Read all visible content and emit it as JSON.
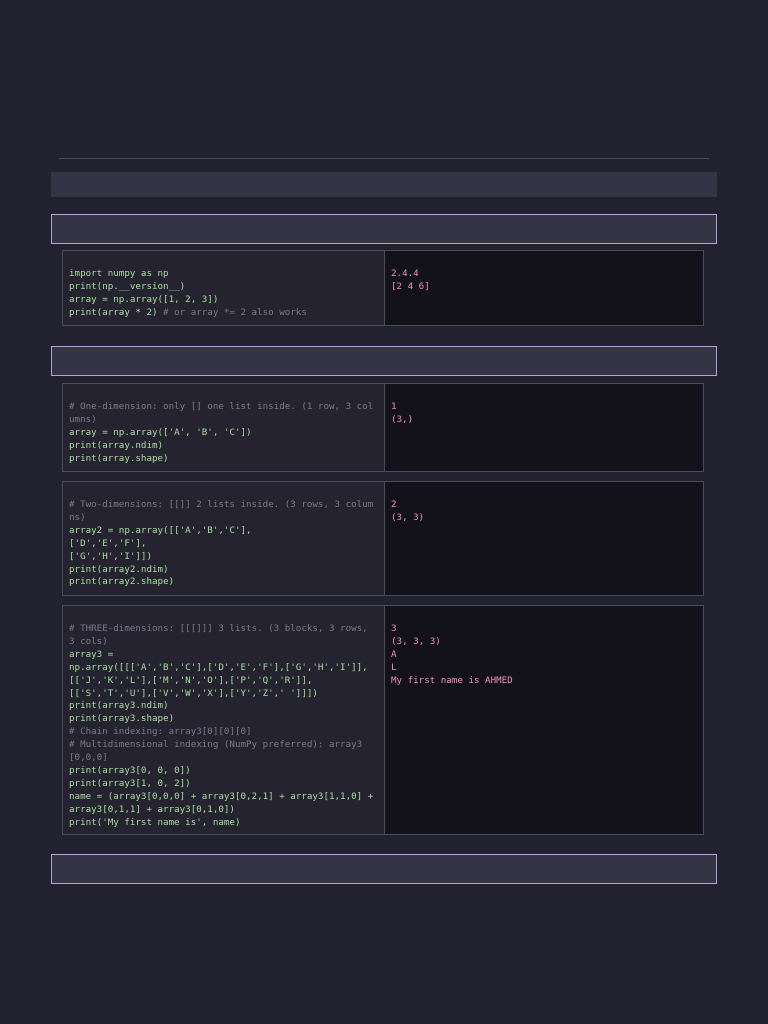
{
  "cells": [
    {
      "code": [
        {
          "text": "import numpy as np",
          "comment": false
        },
        {
          "text": "print(np.__version__)",
          "comment": false
        },
        {
          "text": "array = np.array([1, 2, 3])",
          "comment": false
        },
        {
          "text": "print(array * 2) ",
          "comment": false,
          "tail": "# or array *= 2 also works"
        }
      ],
      "output": [
        "2.4.4",
        "[2 4 6]"
      ]
    },
    {
      "code": [
        {
          "text": "# One-dimension: only [] one list inside. (1 row, 3 columns)",
          "comment": true
        },
        {
          "text": "array = np.array(['A', 'B', 'C'])",
          "comment": false
        },
        {
          "text": "print(array.ndim)",
          "comment": false
        },
        {
          "text": "print(array.shape)",
          "comment": false
        }
      ],
      "output": [
        "1",
        "(3,)"
      ]
    },
    {
      "code": [
        {
          "text": "# Two-dimensions: [[]] 2 lists inside. (3 rows, 3 columns)",
          "comment": true
        },
        {
          "text": "array2 = np.array([['A','B','C'],",
          "comment": false
        },
        {
          "text": "['D','E','F'],",
          "comment": false
        },
        {
          "text": "['G','H','I']])",
          "comment": false
        },
        {
          "text": "print(array2.ndim)",
          "comment": false
        },
        {
          "text": "print(array2.shape)",
          "comment": false
        }
      ],
      "output": [
        "2",
        "(3, 3)"
      ]
    },
    {
      "code": [
        {
          "text": "# THREE-dimensions: [[[]]] 3 lists. (3 blocks, 3 rows, 3 cols)",
          "comment": true
        },
        {
          "text": "array3 =",
          "comment": false
        },
        {
          "text": "np.array([[['A','B','C'],['D','E','F'],['G','H','I']],",
          "comment": false
        },
        {
          "text": "[['J','K','L'],['M','N','O'],['P','Q','R']],",
          "comment": false
        },
        {
          "text": "[['S','T','U'],['V','W','X'],['Y','Z',' ']]])",
          "comment": false
        },
        {
          "text": "print(array3.ndim)",
          "comment": false
        },
        {
          "text": "print(array3.shape)",
          "comment": false
        },
        {
          "text": "# Chain indexing: array3[0][0][0]",
          "comment": true
        },
        {
          "text": "# Multidimensional indexing (NumPy preferred): array3[0,0,0]",
          "comment": true
        },
        {
          "text": "print(array3[0, 0, 0])",
          "comment": false
        },
        {
          "text": "print(array3[1, 0, 2])",
          "comment": false
        },
        {
          "text": "name = (array3[0,0,0] + array3[0,2,1] + array3[1,1,0] + array3[0,1,1] + array3[0,1,0])",
          "comment": false
        },
        {
          "text": "print('My first name is', name)",
          "comment": false
        }
      ],
      "output": [
        "3",
        "(3, 3, 3)",
        "A",
        "L",
        "My first name is AHMED"
      ]
    }
  ]
}
